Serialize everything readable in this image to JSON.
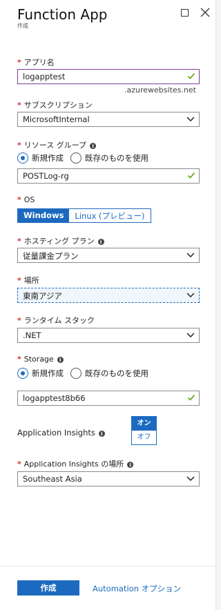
{
  "header": {
    "title": "Function App",
    "subtitle": "作成"
  },
  "app_name": {
    "label": "アプリ名",
    "value": "logapptest",
    "suffix": ".azurewebsites.net"
  },
  "subscription": {
    "label": "サブスクリプション",
    "value": "MicrosoftInternal"
  },
  "resource_group": {
    "label": "リソース グループ",
    "option_new": "新規作成",
    "option_existing": "既存のものを使用",
    "value": "POSTLog-rg"
  },
  "os": {
    "label": "OS",
    "option_windows": "Windows",
    "option_linux": "Linux (プレビュー)",
    "selected": "Windows"
  },
  "hosting_plan": {
    "label": "ホスティング プラン",
    "value": "従量課金プラン"
  },
  "location": {
    "label": "場所",
    "value": "東南アジア"
  },
  "runtime": {
    "label": "ランタイム スタック",
    "value": ".NET"
  },
  "storage": {
    "label": "Storage",
    "option_new": "新規作成",
    "option_existing": "既存のものを使用",
    "value": "logapptest8b66"
  },
  "app_insights": {
    "label": "Application Insights",
    "on": "オン",
    "off": "オフ",
    "selected": "オン"
  },
  "app_insights_location": {
    "label": "Application Insights の場所",
    "value": "Southeast Asia"
  },
  "footer": {
    "create_label": "作成",
    "automation_label": "Automation オプション"
  },
  "colors": {
    "accent": "#1c6ac0",
    "required": "#d13438",
    "valid": "#57a300"
  },
  "icons": [
    "maximize-icon",
    "close-icon",
    "info-icon",
    "checkmark-icon",
    "chevron-down-icon"
  ]
}
